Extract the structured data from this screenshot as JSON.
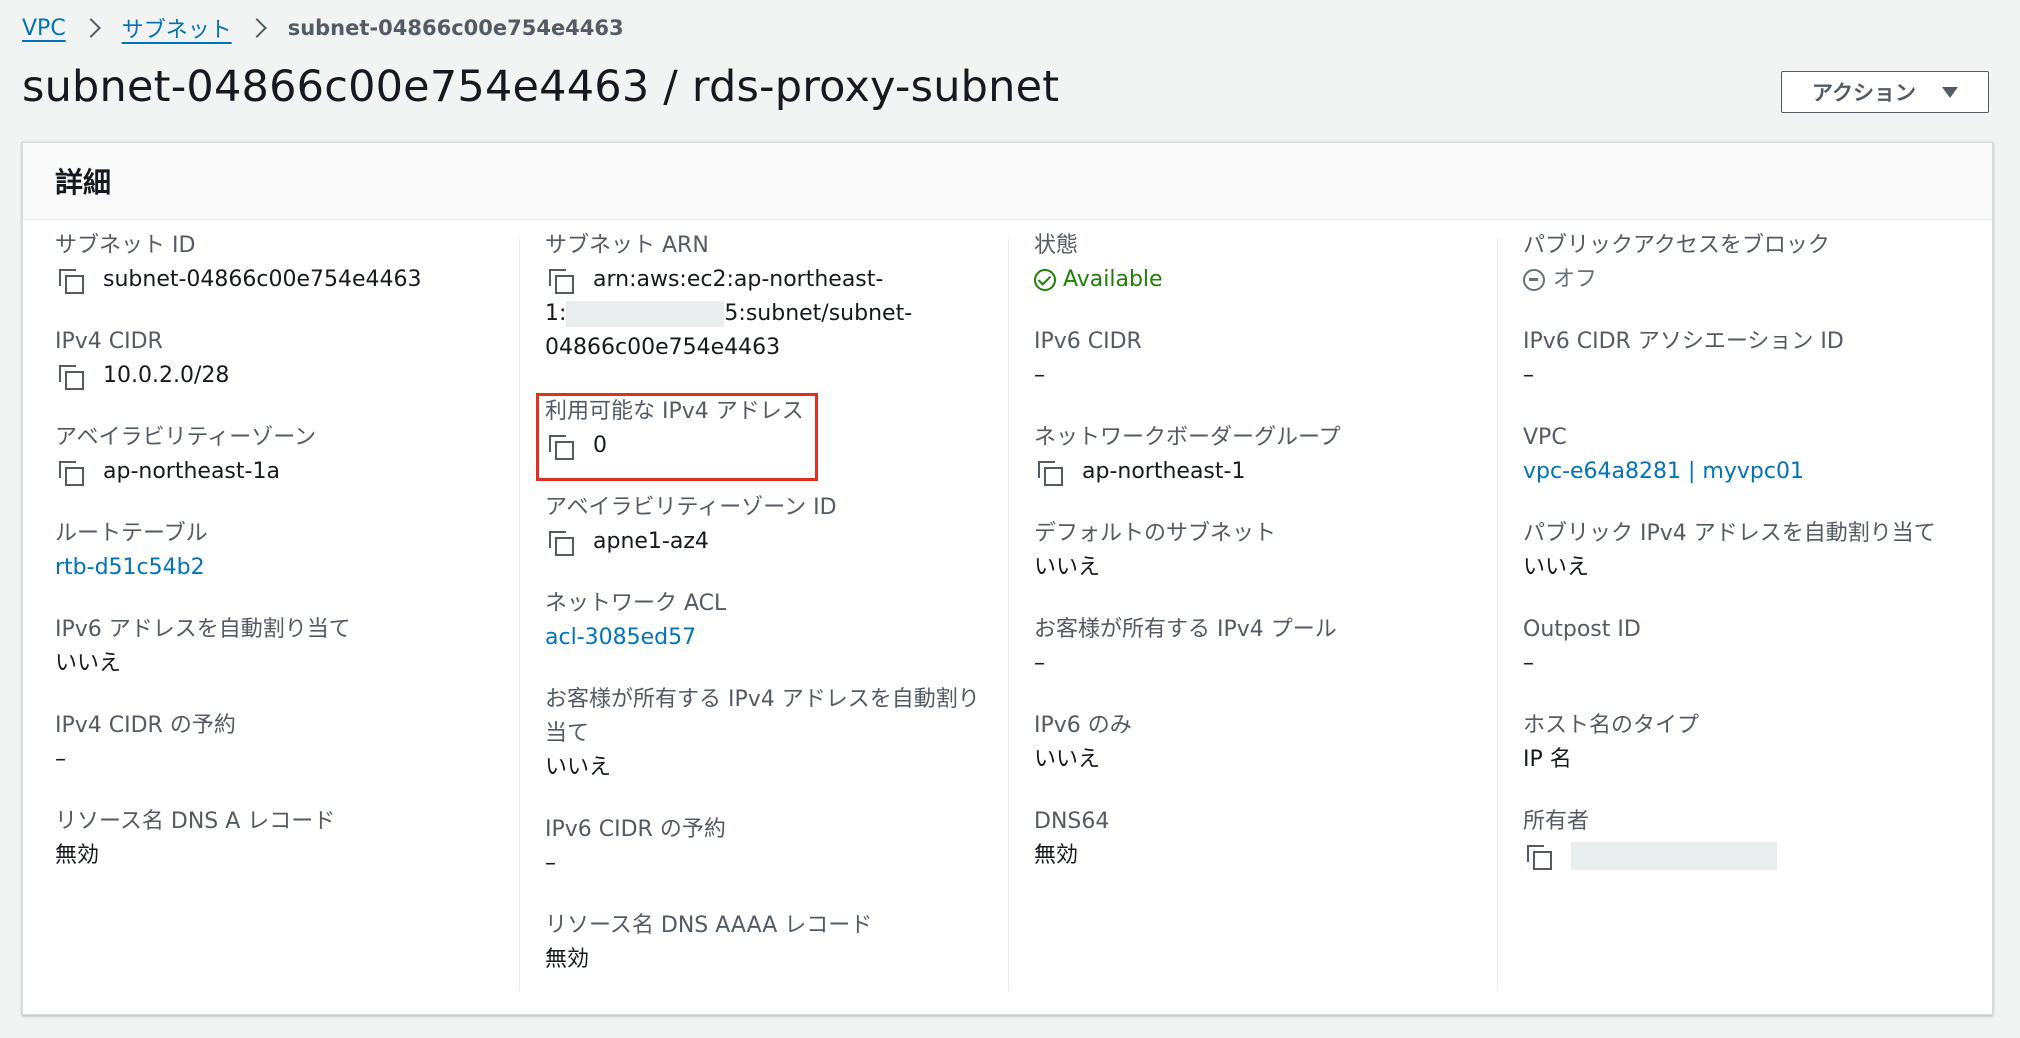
{
  "breadcrumb": {
    "vpc": "VPC",
    "subnets": "サブネット",
    "current": "subnet-04866c00e754e4463"
  },
  "page_title": "subnet-04866c00e754e4463 / rds-proxy-subnet",
  "actions_label": "アクション",
  "panel_title": "詳細",
  "col1": {
    "subnet_id": {
      "label": "サブネット ID",
      "value": "subnet-04866c00e754e4463"
    },
    "ipv4_cidr": {
      "label": "IPv4 CIDR",
      "value": "10.0.2.0/28"
    },
    "az": {
      "label": "アベイラビリティーゾーン",
      "value": "ap-northeast-1a"
    },
    "route_table": {
      "label": "ルートテーブル",
      "value": "rtb-d51c54b2"
    },
    "ipv6_auto": {
      "label": "IPv6 アドレスを自動割り当て",
      "value": "いいえ"
    },
    "ipv4_reserve": {
      "label": "IPv4 CIDR の予約",
      "value": "–"
    },
    "dns_a": {
      "label": "リソース名 DNS A レコード",
      "value": "無効"
    }
  },
  "col2": {
    "arn": {
      "label": "サブネット ARN",
      "line1": "arn:aws:ec2:ap-northeast-",
      "line2_prefix": "1:",
      "line2_suffix": "5:subnet/subnet-",
      "line3": "04866c00e754e4463"
    },
    "available_ipv4": {
      "label": "利用可能な IPv4 アドレス",
      "value": "0"
    },
    "az_id": {
      "label": "アベイラビリティーゾーン ID",
      "value": "apne1-az4"
    },
    "network_acl": {
      "label": "ネットワーク ACL",
      "value": "acl-3085ed57"
    },
    "customer_ipv4_auto": {
      "label_line1": "お客様が所有する IPv4 アドレスを自動割り",
      "label_line2": "当て",
      "value": "いいえ"
    },
    "ipv6_reserve": {
      "label": "IPv6 CIDR の予約",
      "value": "–"
    },
    "dns_aaaa": {
      "label": "リソース名 DNS AAAA レコード",
      "value": "無効"
    }
  },
  "col3": {
    "state": {
      "label": "状態",
      "value": "Available"
    },
    "ipv6_cidr": {
      "label": "IPv6 CIDR",
      "value": "–"
    },
    "border_group": {
      "label": "ネットワークボーダーグループ",
      "value": "ap-northeast-1"
    },
    "default_subnet": {
      "label": "デフォルトのサブネット",
      "value": "いいえ"
    },
    "customer_pool": {
      "label": "お客様が所有する IPv4 プール",
      "value": "–"
    },
    "ipv6_only": {
      "label": "IPv6 のみ",
      "value": "いいえ"
    },
    "dns64": {
      "label": "DNS64",
      "value": "無効"
    }
  },
  "col4": {
    "block_public": {
      "label": "パブリックアクセスをブロック",
      "value": "オフ"
    },
    "ipv6_assoc": {
      "label": "IPv6 CIDR アソシエーション ID",
      "value": "–"
    },
    "vpc": {
      "label": "VPC",
      "value": "vpc-e64a8281 | myvpc01"
    },
    "public_ipv4_auto": {
      "label": "パブリック IPv4 アドレスを自動割り当て",
      "value": "いいえ"
    },
    "outpost": {
      "label": "Outpost ID",
      "value": "–"
    },
    "hostname_type": {
      "label": "ホスト名のタイプ",
      "value": "IP 名"
    },
    "owner": {
      "label": "所有者",
      "value": ""
    }
  },
  "colors": {
    "link": "#0073bb",
    "success": "#1d8102",
    "highlight": "#e1301f"
  }
}
